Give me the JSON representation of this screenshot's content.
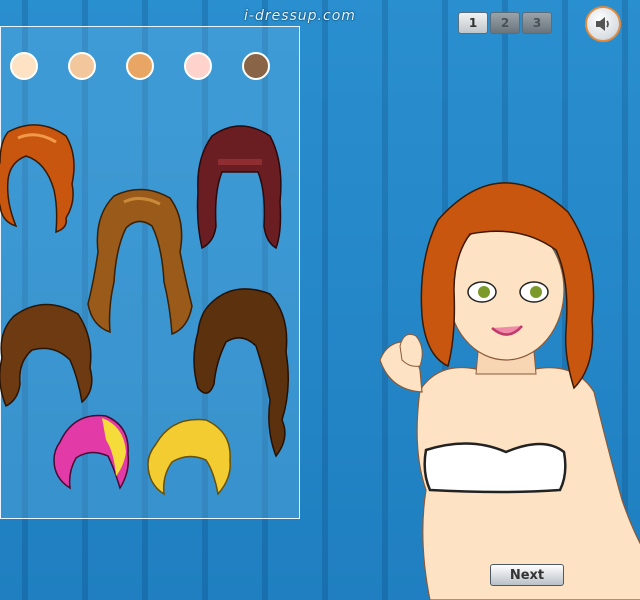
{
  "header": {
    "site_name": "i-dressup.com",
    "steps": [
      {
        "label": "1",
        "active": true
      },
      {
        "label": "2",
        "active": false
      },
      {
        "label": "3",
        "active": false
      }
    ],
    "sound_icon": "speaker-icon"
  },
  "panel": {
    "skin_tones": [
      "#fde3c4",
      "#f3c79c",
      "#e8a563",
      "#fdd3cc",
      "#8a6446"
    ],
    "hairstyles": [
      {
        "name": "orange-curly-hair",
        "color": "#c9560e"
      },
      {
        "name": "long-burgundy-hair",
        "color": "#6b1e22"
      },
      {
        "name": "long-light-brown-hair",
        "color": "#9a5a1a"
      },
      {
        "name": "short-brown-wavy-hair",
        "color": "#6e3a12"
      },
      {
        "name": "long-brown-side-hair",
        "color": "#5c320e"
      },
      {
        "name": "pink-yellow-short-hair",
        "color": "#e23aa6"
      },
      {
        "name": "blonde-short-hair",
        "color": "#f2cc30"
      }
    ]
  },
  "colors": {
    "background": "#2a8fcf",
    "accent": "#e58a3a"
  },
  "footer": {
    "next_label": "Next"
  }
}
